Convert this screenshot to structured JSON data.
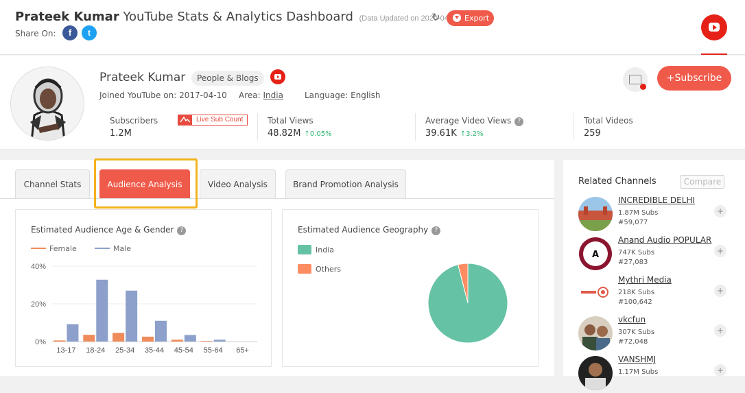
{
  "header": {
    "channel_name": "Prateek Kumar",
    "title": "YouTube Stats & Analytics Dashboard",
    "updated": "(Data Updated on 2020-04-24)",
    "export_label": "Export",
    "share_label": "Share On:",
    "facebook_glyph": "f",
    "twitter_glyph": "t",
    "refresh_glyph": "↻"
  },
  "profile": {
    "name": "Prateek Kumar",
    "category": "People & Blogs",
    "joined_label": "Joined YouTube on:",
    "joined": "2017-04-10",
    "area_label": "Area:",
    "area": "India",
    "language_label": "Language:",
    "language": "English",
    "subscribe_label": "Subscribe",
    "subscribe_glyph": "+"
  },
  "stats": {
    "subscribers_label": "Subscribers",
    "subscribers": "1.2M",
    "live_sub_label": "Live Sub Count",
    "total_views_label": "Total Views",
    "total_views": "48.82M",
    "total_views_change": "0.05%",
    "avg_views_label": "Average Video Views",
    "avg_views": "39.61K",
    "avg_views_change": "3.2%",
    "total_videos_label": "Total Videos",
    "total_videos": "259",
    "up_arrow": "↑",
    "help_glyph": "?"
  },
  "tabs": [
    {
      "label": "Channel Stats"
    },
    {
      "label": "Audience Analysis"
    },
    {
      "label": "Video Analysis"
    },
    {
      "label": "Brand Promotion Analysis"
    }
  ],
  "age_gender": {
    "title": "Estimated Audience Age & Gender",
    "female_label": "Female",
    "male_label": "Male"
  },
  "geography": {
    "title": "Estimated Audience Geography",
    "india_label": "India",
    "others_label": "Others"
  },
  "colors": {
    "accent": "#f05a4a",
    "female": "#f08c5c",
    "male": "#8da0cb",
    "india": "#66c2a5",
    "others": "#fc8d62",
    "highlight": "#f3b21d"
  },
  "chart_data": [
    {
      "type": "bar",
      "title": "Estimated Audience Age & Gender",
      "categories": [
        "13-17",
        "18-24",
        "25-34",
        "35-44",
        "45-54",
        "55-64",
        "65+"
      ],
      "y_ticks": [
        "0%",
        "20%",
        "40%"
      ],
      "ylim": [
        0,
        40
      ],
      "series": [
        {
          "name": "Female",
          "values": [
            0.6,
            3.6,
            4.6,
            2.6,
            1.0,
            0.3,
            0
          ]
        },
        {
          "name": "Male",
          "values": [
            9.2,
            32.8,
            27.0,
            11.0,
            3.5,
            1.0,
            0
          ]
        }
      ],
      "legend": "top-left"
    },
    {
      "type": "pie",
      "title": "Estimated Audience Geography",
      "labels": [
        "India",
        "Others"
      ],
      "values": [
        96,
        4
      ],
      "legend": "left"
    }
  ],
  "related": {
    "title": "Related Channels",
    "compare_label": "Compare",
    "plus_glyph": "+",
    "channels": [
      {
        "name": "INCREDIBLE DELHI",
        "subs": "1.87M Subs",
        "rank": "#59,077"
      },
      {
        "name": "Anand Audio POPULAR",
        "subs": "747K Subs",
        "rank": "#27,083"
      },
      {
        "name": "Mythri Media",
        "subs": "218K Subs",
        "rank": "#100,642"
      },
      {
        "name": "vkcfun",
        "subs": "307K Subs",
        "rank": "#72,048"
      },
      {
        "name": "VANSHMJ",
        "subs": "1.17M Subs",
        "rank": ""
      }
    ]
  }
}
